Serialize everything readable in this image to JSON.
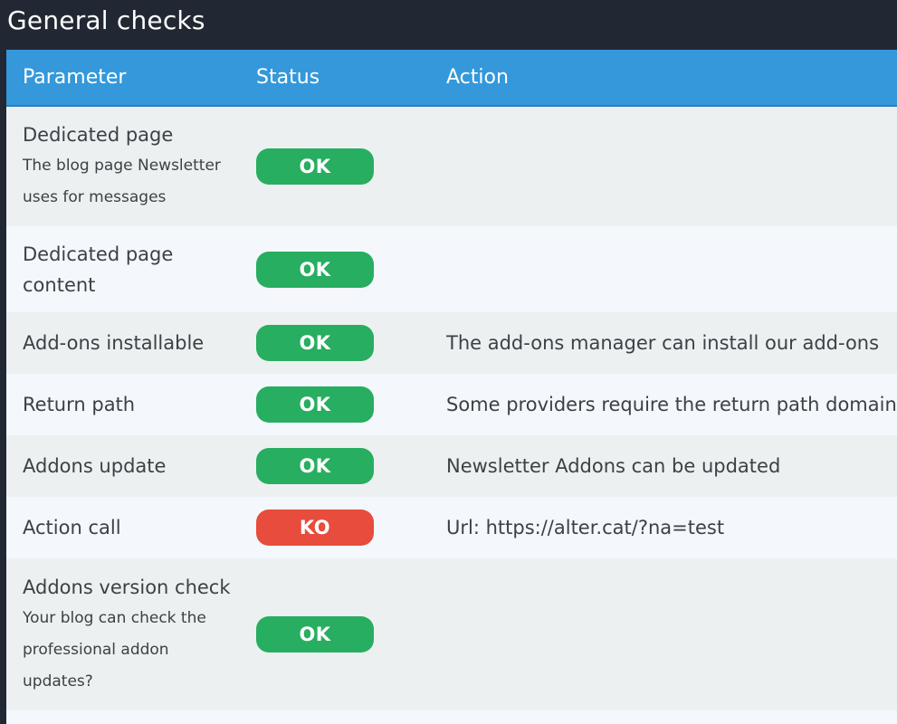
{
  "page_title": "General checks",
  "columns": {
    "parameter": "Parameter",
    "status": "Status",
    "action": "Action"
  },
  "colors": {
    "header_bg": "#3498db",
    "ok": "#27ae60",
    "ko": "#e74c3c",
    "title_bar": "#222833"
  },
  "rows": [
    {
      "name": "Dedicated page",
      "desc_line1": "The blog page Newsletter",
      "desc_line2": "uses for messages",
      "status": "OK",
      "action": ""
    },
    {
      "name_line1": "Dedicated page",
      "name_line2": "content",
      "status": "OK",
      "action": ""
    },
    {
      "name": "Add-ons installable",
      "status": "OK",
      "action": "The add-ons manager can install our add-ons"
    },
    {
      "name": "Return path",
      "status": "OK",
      "action": "Some providers require the return path domain"
    },
    {
      "name": "Addons update",
      "status": "OK",
      "action": "Newsletter Addons can be updated"
    },
    {
      "name": "Action call",
      "status": "KO",
      "action": "Url: https://alter.cat/?na=test"
    },
    {
      "name": "Addons version check",
      "desc_line1": "Your blog can check the",
      "desc_line2": "professional addon",
      "desc_line3": "updates?",
      "status": "OK",
      "action": ""
    }
  ]
}
